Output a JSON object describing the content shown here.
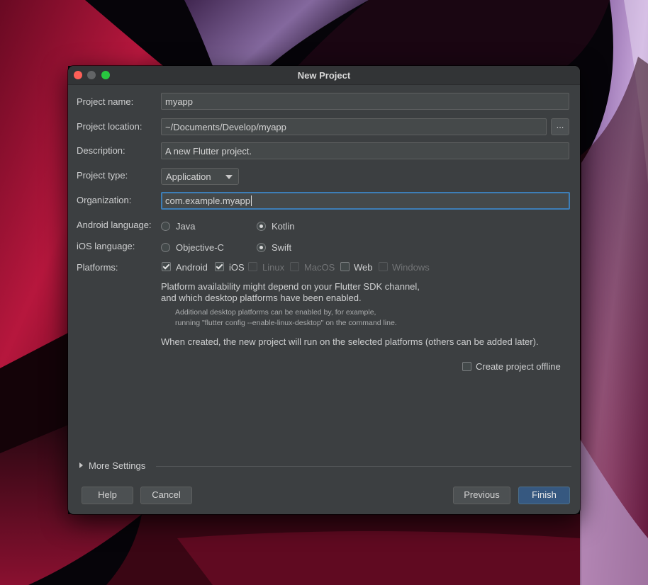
{
  "window": {
    "title": "New Project"
  },
  "form": {
    "project_name": {
      "label": "Project name:",
      "value": "myapp"
    },
    "project_location": {
      "label": "Project location:",
      "value": "~/Documents/Develop/myapp",
      "browse_label": "..."
    },
    "description": {
      "label": "Description:",
      "value": "A new Flutter project."
    },
    "project_type": {
      "label": "Project type:",
      "value": "Application"
    },
    "organization": {
      "label": "Organization:",
      "value": "com.example.myapp"
    },
    "android_language": {
      "label": "Android language:",
      "options": [
        "Java",
        "Kotlin"
      ],
      "selected": "Kotlin"
    },
    "ios_language": {
      "label": "iOS language:",
      "options": [
        "Objective-C",
        "Swift"
      ],
      "selected": "Swift"
    },
    "platforms": {
      "label": "Platforms:",
      "items": [
        {
          "label": "Android",
          "checked": true,
          "enabled": true
        },
        {
          "label": "iOS",
          "checked": true,
          "enabled": true
        },
        {
          "label": "Linux",
          "checked": false,
          "enabled": false
        },
        {
          "label": "MacOS",
          "checked": false,
          "enabled": false
        },
        {
          "label": "Web",
          "checked": false,
          "enabled": true
        },
        {
          "label": "Windows",
          "checked": false,
          "enabled": false
        }
      ]
    },
    "platform_info_line1": "Platform availability might depend on your Flutter SDK channel,",
    "platform_info_line2": "and which desktop platforms have been enabled.",
    "platform_hint_line1": "Additional desktop platforms can be enabled by, for example,",
    "platform_hint_line2": "running \"flutter config --enable-linux-desktop\" on the command line.",
    "created_note": "When created, the new project will run on the selected platforms (others can be added later).",
    "offline": {
      "label": "Create project offline",
      "checked": false
    }
  },
  "more_settings": {
    "label": "More Settings"
  },
  "buttons": {
    "help": "Help",
    "cancel": "Cancel",
    "previous": "Previous",
    "finish": "Finish"
  },
  "colors": {
    "dialog_bg": "#3c3f41",
    "accent": "#3d7eb7",
    "primary_button": "#365880"
  }
}
